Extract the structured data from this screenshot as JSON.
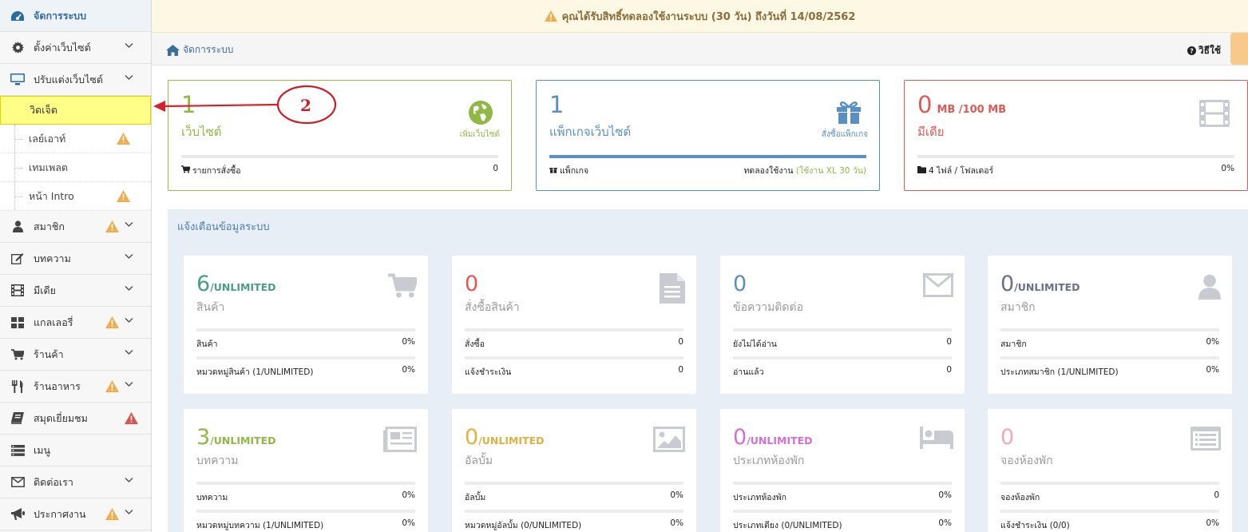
{
  "sidebar": {
    "header": {
      "label": "จัดการระบบ",
      "icon": "dashboard-icon"
    },
    "items": [
      {
        "label": "ตั้งค่าเว็บไซต์",
        "icon": "gear-icon",
        "warn": false,
        "chevron": true
      },
      {
        "label": "ปรับแต่งเว็บไซต์",
        "icon": "desktop-icon",
        "warn": false,
        "chevron": true,
        "expanded": true
      }
    ],
    "sub_items": [
      {
        "label": "วิดเจ็ต",
        "active": true,
        "warn": false
      },
      {
        "label": "เลย์เอาท์",
        "active": false,
        "warn": true
      },
      {
        "label": "เทมเพลต",
        "active": false,
        "warn": false
      },
      {
        "label": "หน้า Intro",
        "active": false,
        "warn": true
      }
    ],
    "items2": [
      {
        "label": "สมาชิก",
        "icon": "user-icon",
        "warn": true,
        "warn_color": "#f0ad4e",
        "chevron": true
      },
      {
        "label": "บทความ",
        "icon": "edit-icon",
        "warn": false,
        "chevron": true
      },
      {
        "label": "มีเดีย",
        "icon": "film-icon",
        "warn": false,
        "chevron": true
      },
      {
        "label": "แกลเลอรี่",
        "icon": "grid-icon",
        "warn": true,
        "warn_color": "#f0ad4e",
        "chevron": true
      },
      {
        "label": "ร้านค้า",
        "icon": "cart-icon",
        "warn": false,
        "chevron": true
      },
      {
        "label": "ร้านอาหาร",
        "icon": "cutlery-icon",
        "warn": true,
        "warn_color": "#f0ad4e",
        "chevron": true
      },
      {
        "label": "สมุดเยี่ยมชม",
        "icon": "book-icon",
        "warn": true,
        "warn_color": "#d9534f",
        "chevron": false
      },
      {
        "label": "เมนู",
        "icon": "menu-list-icon",
        "warn": false,
        "chevron": false
      },
      {
        "label": "ติดต่อเรา",
        "icon": "envelope-icon",
        "warn": false,
        "chevron": true
      },
      {
        "label": "ประกาศงาน",
        "icon": "bullhorn-icon",
        "warn": true,
        "warn_color": "#f0ad4e",
        "chevron": true
      }
    ]
  },
  "banner": {
    "text": "คุณได้รับสิทธิ์ทดลองใช้งานระบบ (30 วัน) ถึงวันที่ 14/08/2562",
    "icon": "warning-icon"
  },
  "breadcrumb": {
    "text": "จัดการระบบ",
    "icon": "home-icon"
  },
  "help": {
    "text": "วิธีใช้",
    "icon": "question-circle-icon"
  },
  "summary_cards": [
    {
      "num": "1",
      "unit": "",
      "label": "เว็บไซต์",
      "action": "เพิ่มเว็บไซต์",
      "icon": "globe-icon",
      "foot_left": "รายการสั่งซื้อ",
      "foot_icon": "cart-icon",
      "foot_right": "0",
      "progress": 0,
      "color": "#8fb845",
      "border": "#9ab84a"
    },
    {
      "num": "1",
      "unit": "",
      "label": "แพ็กเกจเว็บไซต์",
      "action": "สั่งซื้อแพ็กเกจ",
      "icon": "gift-icon",
      "foot_left": "แพ็กเกจ",
      "foot_icon": "gift-icon",
      "foot_right": "ทดลองใช้งาน",
      "foot_right_extra": "(ใช้งาน XL 30 วัน)",
      "progress": 100,
      "color": "#5a8fc4",
      "border": "#5a8fc4"
    },
    {
      "num": "0",
      "unit": "MB  /100 MB",
      "label": "มีเดีย",
      "action": "",
      "icon": "film-icon",
      "foot_left": "4 ไฟล์ / โฟลเดอร์",
      "foot_icon": "folder-icon",
      "foot_right": "0%",
      "progress": 0,
      "color": "#e05a55",
      "border": "#e05a55"
    }
  ],
  "notify": {
    "title": "แจ้งเตือนข้อมูลระบบ",
    "cards": [
      {
        "num": "6",
        "unit": "/UNLIMITED",
        "label": "สินค้า",
        "icon": "cart-icon",
        "color": "#4a9e84",
        "rows": [
          {
            "label": "สินค้า",
            "value": "0%"
          },
          {
            "label": "หมวดหมู่สินค้า (1/UNLIMITED)",
            "value": "0%"
          }
        ]
      },
      {
        "num": "0",
        "unit": "",
        "label": "สั่งซื้อสินค้า",
        "icon": "document-icon",
        "color": "#e05a55",
        "rows": [
          {
            "label": "สั่งซื้อ",
            "value": "0"
          },
          {
            "label": "แจ้งชำระเงิน",
            "value": "0"
          }
        ]
      },
      {
        "num": "0",
        "unit": "",
        "label": "ข้อความติดต่อ",
        "icon": "envelope-icon",
        "color": "#5a8fc4",
        "rows": [
          {
            "label": "ยังไม่ได้อ่าน",
            "value": "0"
          },
          {
            "label": "อ่านแล้ว",
            "value": "0"
          }
        ]
      },
      {
        "num": "0",
        "unit": "/UNLIMITED",
        "label": "สมาชิก",
        "icon": "user-icon",
        "color": "#6b6f8a",
        "rows": [
          {
            "label": "สมาชิก",
            "value": "0%"
          },
          {
            "label": "ประเภทสมาชิก (1/UNLIMITED)",
            "value": "0%"
          }
        ]
      },
      {
        "num": "3",
        "unit": "/UNLIMITED",
        "label": "บทความ",
        "icon": "newspaper-icon",
        "color": "#8fb845",
        "rows": [
          {
            "label": "บทความ",
            "value": "0%"
          },
          {
            "label": "หมวดหมู่บทความ (1/UNLIMITED)",
            "value": "0%"
          }
        ]
      },
      {
        "num": "0",
        "unit": "/UNLIMITED",
        "label": "อัลบั้ม",
        "icon": "picture-icon",
        "color": "#e0b040",
        "rows": [
          {
            "label": "อัลบั้ม",
            "value": "0%"
          },
          {
            "label": "หมวดหมู่อัลบั้ม (0/UNLIMITED)",
            "value": "0%"
          }
        ]
      },
      {
        "num": "0",
        "unit": "/UNLIMITED",
        "label": "ประเภทห้องพัก",
        "icon": "bed-icon",
        "color": "#d46fd4",
        "rows": [
          {
            "label": "ประเภทห้องพัก",
            "value": "0%"
          },
          {
            "label": "ประเภทเตียง (0/UNLIMITED)",
            "value": "0%"
          }
        ]
      },
      {
        "num": "0",
        "unit": "",
        "label": "จองห้องพัก",
        "icon": "list-alt-icon",
        "color": "#f0a8b8",
        "rows": [
          {
            "label": "จองห้องพัก",
            "value": "0"
          },
          {
            "label": "แจ้งชำระเงิน (0/0)",
            "value": "0%"
          }
        ]
      }
    ]
  },
  "annotation": {
    "number": "2"
  }
}
